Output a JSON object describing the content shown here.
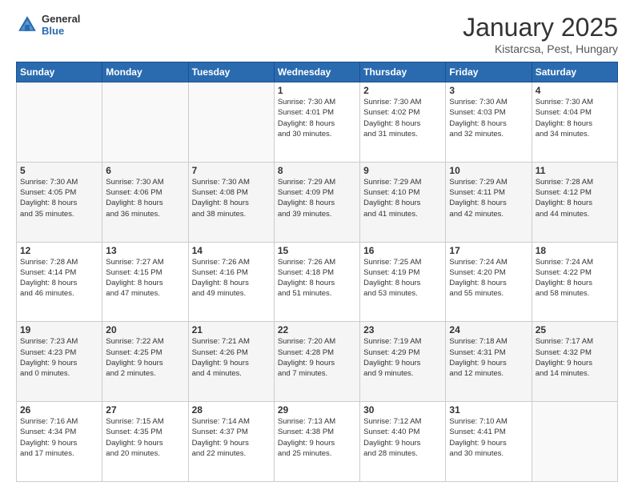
{
  "header": {
    "logo_general": "General",
    "logo_blue": "Blue",
    "main_title": "January 2025",
    "subtitle": "Kistarcsa, Pest, Hungary"
  },
  "days_of_week": [
    "Sunday",
    "Monday",
    "Tuesday",
    "Wednesday",
    "Thursday",
    "Friday",
    "Saturday"
  ],
  "weeks": [
    [
      {
        "num": "",
        "info": ""
      },
      {
        "num": "",
        "info": ""
      },
      {
        "num": "",
        "info": ""
      },
      {
        "num": "1",
        "info": "Sunrise: 7:30 AM\nSunset: 4:01 PM\nDaylight: 8 hours\nand 30 minutes."
      },
      {
        "num": "2",
        "info": "Sunrise: 7:30 AM\nSunset: 4:02 PM\nDaylight: 8 hours\nand 31 minutes."
      },
      {
        "num": "3",
        "info": "Sunrise: 7:30 AM\nSunset: 4:03 PM\nDaylight: 8 hours\nand 32 minutes."
      },
      {
        "num": "4",
        "info": "Sunrise: 7:30 AM\nSunset: 4:04 PM\nDaylight: 8 hours\nand 34 minutes."
      }
    ],
    [
      {
        "num": "5",
        "info": "Sunrise: 7:30 AM\nSunset: 4:05 PM\nDaylight: 8 hours\nand 35 minutes."
      },
      {
        "num": "6",
        "info": "Sunrise: 7:30 AM\nSunset: 4:06 PM\nDaylight: 8 hours\nand 36 minutes."
      },
      {
        "num": "7",
        "info": "Sunrise: 7:30 AM\nSunset: 4:08 PM\nDaylight: 8 hours\nand 38 minutes."
      },
      {
        "num": "8",
        "info": "Sunrise: 7:29 AM\nSunset: 4:09 PM\nDaylight: 8 hours\nand 39 minutes."
      },
      {
        "num": "9",
        "info": "Sunrise: 7:29 AM\nSunset: 4:10 PM\nDaylight: 8 hours\nand 41 minutes."
      },
      {
        "num": "10",
        "info": "Sunrise: 7:29 AM\nSunset: 4:11 PM\nDaylight: 8 hours\nand 42 minutes."
      },
      {
        "num": "11",
        "info": "Sunrise: 7:28 AM\nSunset: 4:12 PM\nDaylight: 8 hours\nand 44 minutes."
      }
    ],
    [
      {
        "num": "12",
        "info": "Sunrise: 7:28 AM\nSunset: 4:14 PM\nDaylight: 8 hours\nand 46 minutes."
      },
      {
        "num": "13",
        "info": "Sunrise: 7:27 AM\nSunset: 4:15 PM\nDaylight: 8 hours\nand 47 minutes."
      },
      {
        "num": "14",
        "info": "Sunrise: 7:26 AM\nSunset: 4:16 PM\nDaylight: 8 hours\nand 49 minutes."
      },
      {
        "num": "15",
        "info": "Sunrise: 7:26 AM\nSunset: 4:18 PM\nDaylight: 8 hours\nand 51 minutes."
      },
      {
        "num": "16",
        "info": "Sunrise: 7:25 AM\nSunset: 4:19 PM\nDaylight: 8 hours\nand 53 minutes."
      },
      {
        "num": "17",
        "info": "Sunrise: 7:24 AM\nSunset: 4:20 PM\nDaylight: 8 hours\nand 55 minutes."
      },
      {
        "num": "18",
        "info": "Sunrise: 7:24 AM\nSunset: 4:22 PM\nDaylight: 8 hours\nand 58 minutes."
      }
    ],
    [
      {
        "num": "19",
        "info": "Sunrise: 7:23 AM\nSunset: 4:23 PM\nDaylight: 9 hours\nand 0 minutes."
      },
      {
        "num": "20",
        "info": "Sunrise: 7:22 AM\nSunset: 4:25 PM\nDaylight: 9 hours\nand 2 minutes."
      },
      {
        "num": "21",
        "info": "Sunrise: 7:21 AM\nSunset: 4:26 PM\nDaylight: 9 hours\nand 4 minutes."
      },
      {
        "num": "22",
        "info": "Sunrise: 7:20 AM\nSunset: 4:28 PM\nDaylight: 9 hours\nand 7 minutes."
      },
      {
        "num": "23",
        "info": "Sunrise: 7:19 AM\nSunset: 4:29 PM\nDaylight: 9 hours\nand 9 minutes."
      },
      {
        "num": "24",
        "info": "Sunrise: 7:18 AM\nSunset: 4:31 PM\nDaylight: 9 hours\nand 12 minutes."
      },
      {
        "num": "25",
        "info": "Sunrise: 7:17 AM\nSunset: 4:32 PM\nDaylight: 9 hours\nand 14 minutes."
      }
    ],
    [
      {
        "num": "26",
        "info": "Sunrise: 7:16 AM\nSunset: 4:34 PM\nDaylight: 9 hours\nand 17 minutes."
      },
      {
        "num": "27",
        "info": "Sunrise: 7:15 AM\nSunset: 4:35 PM\nDaylight: 9 hours\nand 20 minutes."
      },
      {
        "num": "28",
        "info": "Sunrise: 7:14 AM\nSunset: 4:37 PM\nDaylight: 9 hours\nand 22 minutes."
      },
      {
        "num": "29",
        "info": "Sunrise: 7:13 AM\nSunset: 4:38 PM\nDaylight: 9 hours\nand 25 minutes."
      },
      {
        "num": "30",
        "info": "Sunrise: 7:12 AM\nSunset: 4:40 PM\nDaylight: 9 hours\nand 28 minutes."
      },
      {
        "num": "31",
        "info": "Sunrise: 7:10 AM\nSunset: 4:41 PM\nDaylight: 9 hours\nand 30 minutes."
      },
      {
        "num": "",
        "info": ""
      }
    ]
  ]
}
